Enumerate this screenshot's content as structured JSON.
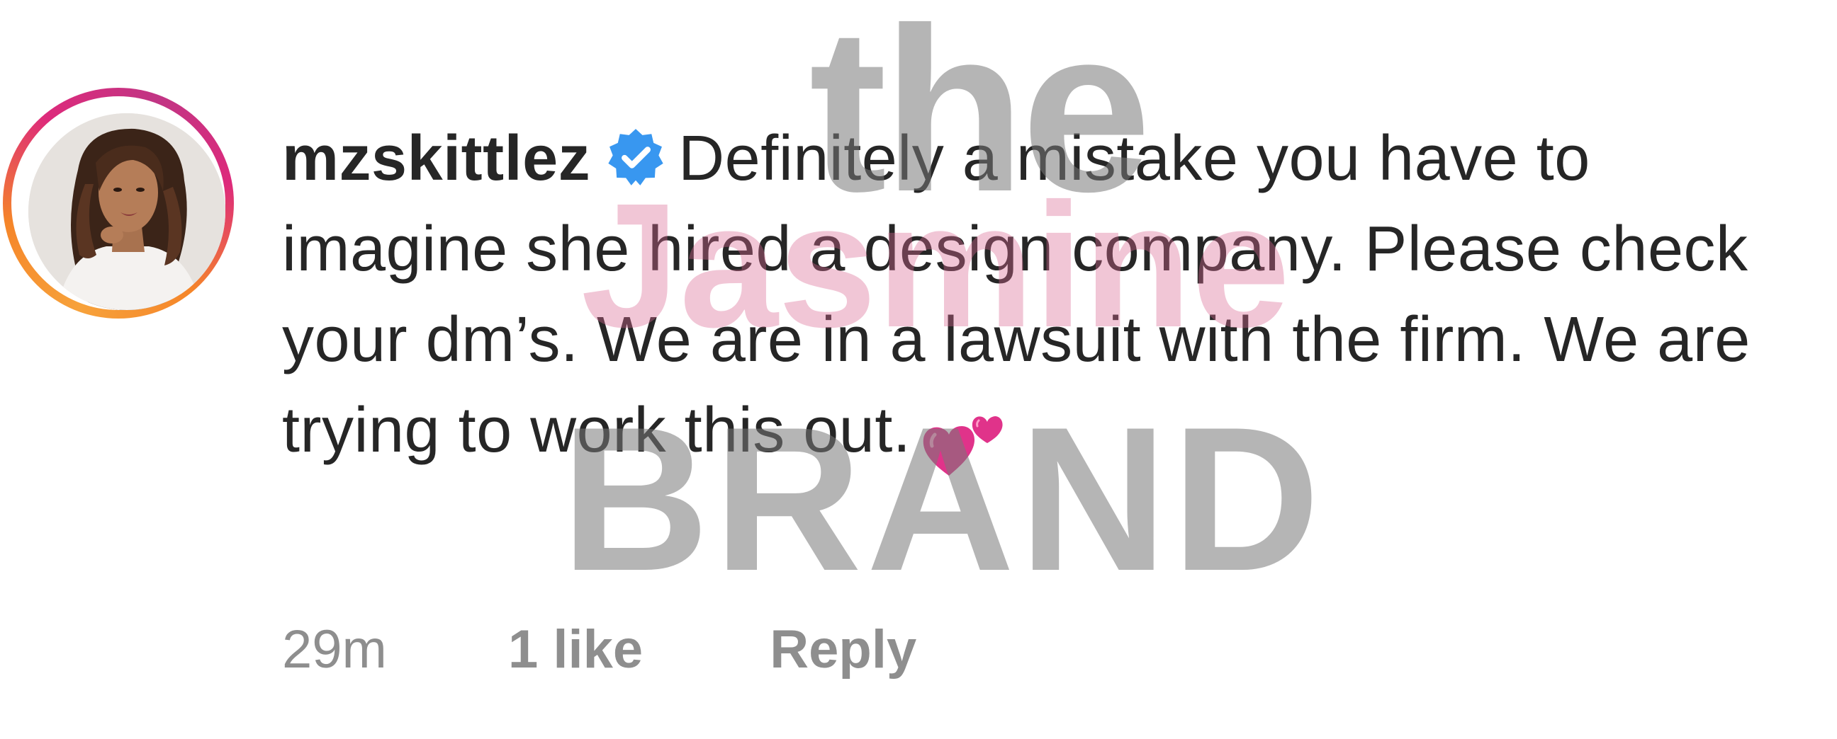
{
  "comment": {
    "avatar_icon": "profile-avatar",
    "username": "mzskittlez",
    "verified_icon": "verified-badge-icon",
    "text": "Definitely a mistake you have to imagine she hired a design company. Please check your dm’s. We are in a lawsuit with the firm. We are trying to work this out.",
    "emoji_icon": "two-hearts-emoji",
    "timestamp": "29m",
    "likes": "1 like",
    "reply_label": "Reply"
  },
  "watermark": {
    "line1": "the",
    "line2": "Jasmine",
    "line3": "BRAND"
  },
  "colors": {
    "text": "#262626",
    "muted": "#8e8e8e",
    "verified_blue": "#3897f0",
    "ring_orange": "#f58529",
    "ring_pink": "#dd2a7b",
    "ring_purple": "#c13584"
  }
}
